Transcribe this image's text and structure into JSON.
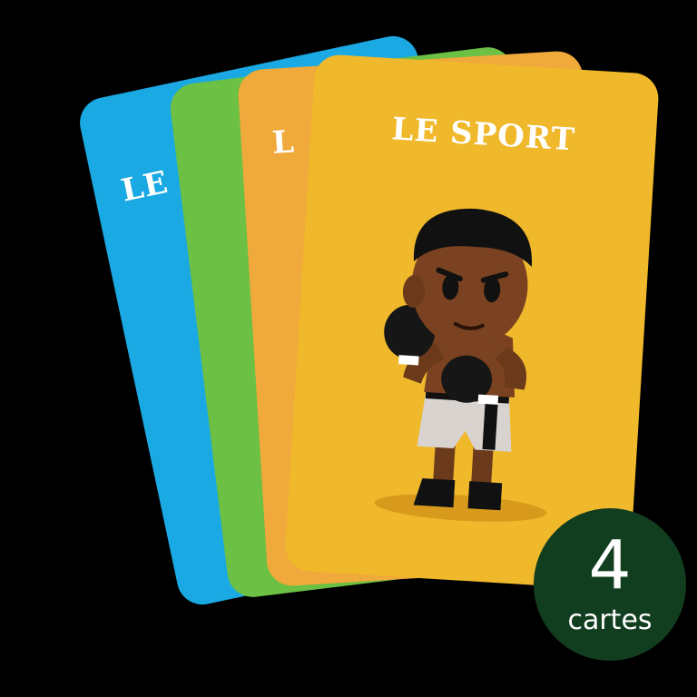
{
  "cards": [
    {
      "title": "LE",
      "color": "#1aa9e3"
    },
    {
      "title": "",
      "color": "#6cc044"
    },
    {
      "title": "L",
      "color": "#f0a93b"
    },
    {
      "title": "LE SPORT",
      "color": "#f0b82b",
      "illustration": "boxer-illustration"
    }
  ],
  "badge": {
    "number": "4",
    "label": "cartes",
    "color": "#123e20"
  },
  "colors": {
    "background": "#000000",
    "text": "#ffffff"
  }
}
